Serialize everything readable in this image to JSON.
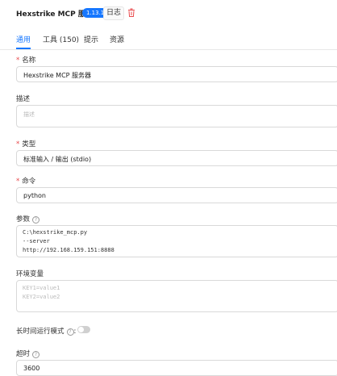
{
  "header": {
    "title": "Hexstrike MCP 服务器",
    "version": "1.13.1",
    "logs_label": "日志",
    "delete_icon": "trash-icon"
  },
  "tabs": [
    {
      "label": "通用",
      "active": true
    },
    {
      "label": "工具 (150)",
      "active": false
    },
    {
      "label": "提示",
      "active": false
    },
    {
      "label": "资源",
      "active": false
    }
  ],
  "form": {
    "name": {
      "label": "名称",
      "required": true,
      "value": "Hexstrike MCP 服务器"
    },
    "description": {
      "label": "描述",
      "required": false,
      "placeholder": "描述"
    },
    "type": {
      "label": "类型",
      "required": true,
      "value": "标准输入 / 输出 (stdio)"
    },
    "command": {
      "label": "命令",
      "required": true,
      "value": "python"
    },
    "args": {
      "label": "参数",
      "lines": [
        "C:\\hexstrike_mcp.py",
        "--server",
        "http://192.168.159.151:8888"
      ]
    },
    "env": {
      "label": "环境变量",
      "placeholder_lines": [
        "KEY1=value1",
        "KEY2=value2"
      ]
    },
    "long_running": {
      "label": "长时间运行模式",
      "enabled": false
    },
    "timeout": {
      "label": "超时",
      "value": "3600"
    }
  },
  "colors": {
    "accent": "#1677ff",
    "required": "#e8474a",
    "delete": "#e8474a"
  }
}
